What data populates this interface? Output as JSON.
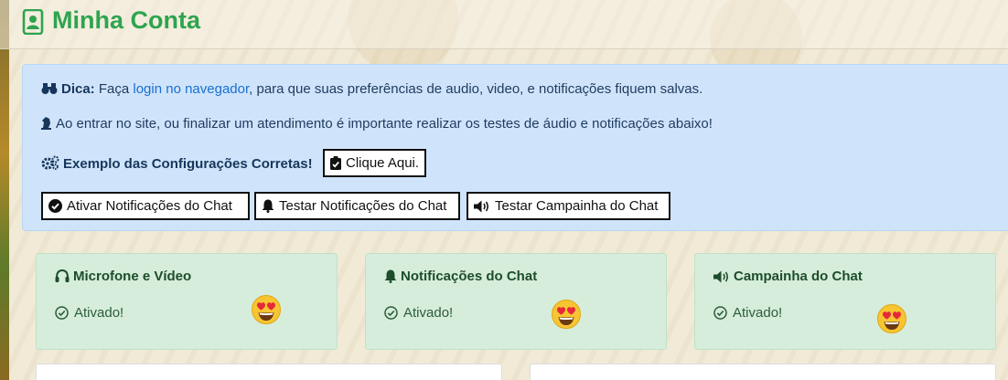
{
  "header": {
    "title": "Minha Conta"
  },
  "tip": {
    "label": "Dica:",
    "text_before": " Faça ",
    "link": "login no navegador",
    "text_after": ", para que suas preferências de audio, video, e notificações fiquem salvas."
  },
  "notice": "Ao entrar no site, ou finalizar um atendimento é importante realizar os testes de áudio e notificações abaixo!",
  "example": {
    "label": "Exemplo das Configurações Corretas!",
    "button": "Clique Aqui."
  },
  "actions": [
    {
      "label": "Ativar Notificações do Chat",
      "icon": "check-circle-icon"
    },
    {
      "label": "Testar Notificações do Chat",
      "icon": "bell-icon"
    },
    {
      "label": "Testar Campainha do Chat",
      "icon": "volume-icon"
    }
  ],
  "cards": [
    {
      "title": "Microfone e Vídeo",
      "icon": "headset-icon",
      "status": "Ativado!",
      "emoji": "heart-eyes-emoji"
    },
    {
      "title": "Notificações do Chat",
      "icon": "bell-icon",
      "status": "Ativado!",
      "emoji": "heart-eyes-emoji"
    },
    {
      "title": "Campainha do Chat",
      "icon": "volume-icon",
      "status": "Ativado!",
      "emoji": "heart-eyes-emoji"
    }
  ],
  "colors": {
    "accent": "#2ea44f",
    "tip_bg": "#cfe4fb",
    "card_bg": "#d6eddb",
    "link": "#1a6fd1"
  }
}
